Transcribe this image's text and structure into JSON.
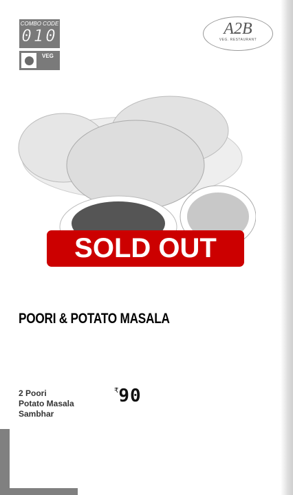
{
  "combo": {
    "label": "COMBO CODE",
    "code": "010"
  },
  "veg": {
    "label": "VEG"
  },
  "logo": {
    "mark": "A2B",
    "subtitle": "VEG. RESTAURANT"
  },
  "status": {
    "label": "SOLD OUT",
    "color": "#cc0000"
  },
  "item": {
    "title": "POORI & POTATO MASALA",
    "components": [
      "2 Poori",
      "Potato Masala",
      "Sambhar"
    ],
    "currency": "₹",
    "price": "90"
  }
}
